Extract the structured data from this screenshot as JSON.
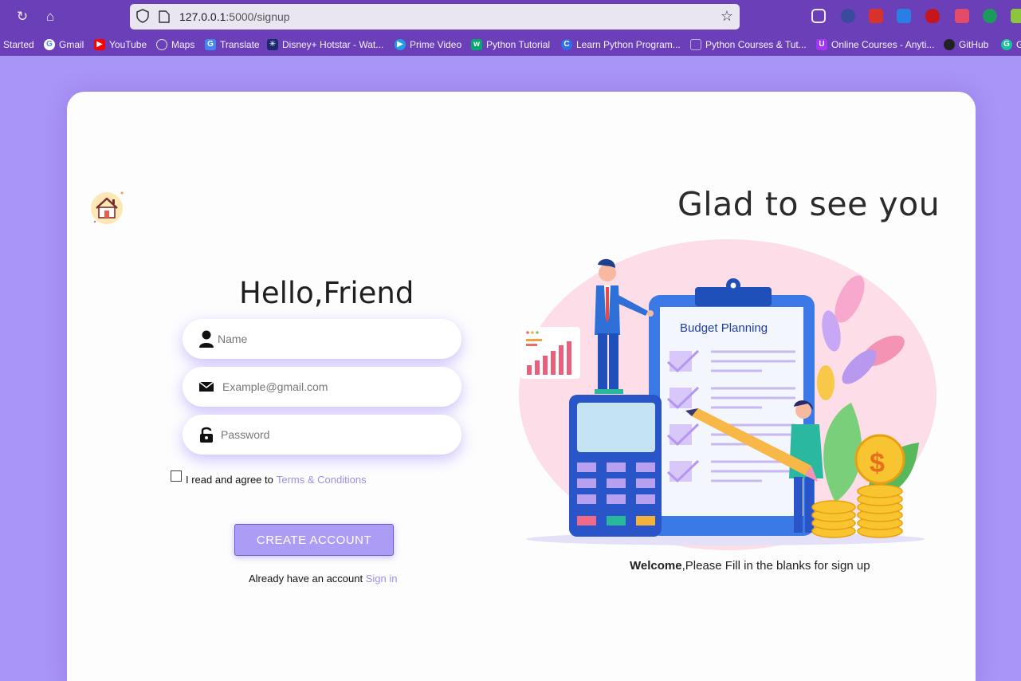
{
  "browser": {
    "url_host": "127.0.0.1",
    "url_path": ":5000/signup",
    "bookmarks": [
      {
        "label": "g Started",
        "icon": "firefox-icon",
        "color": "#ff8a00"
      },
      {
        "label": "Gmail",
        "icon": "google-icon",
        "color": "#ffffff"
      },
      {
        "label": "YouTube",
        "icon": "youtube-icon",
        "color": "#ff0000"
      },
      {
        "label": "Maps",
        "icon": "globe-icon",
        "color": "#d8d8d8"
      },
      {
        "label": "Translate",
        "icon": "translate-icon",
        "color": "#4285f4"
      },
      {
        "label": "Disney+ Hotstar - Wat...",
        "icon": "hotstar-icon",
        "color": "#1a2a6c"
      },
      {
        "label": "Prime Video",
        "icon": "prime-video-icon",
        "color": "#1f9ee8"
      },
      {
        "label": "Python Tutorial",
        "icon": "w3-icon",
        "color": "#04aa6d"
      },
      {
        "label": "Learn Python Program...",
        "icon": "c-icon",
        "color": "#2f6ee6"
      },
      {
        "label": "Python Courses & Tut...",
        "icon": "page-icon",
        "color": "#8b80c8"
      },
      {
        "label": "Online Courses - Anyti...",
        "icon": "udemy-icon",
        "color": "#a435f0"
      },
      {
        "label": "GitHub",
        "icon": "github-icon",
        "color": "#222222"
      },
      {
        "label": "G",
        "icon": "grammarly-icon",
        "color": "#15c39a"
      }
    ]
  },
  "page": {
    "heading": "Hello,Friend",
    "name_placeholder": "Name",
    "email_placeholder": "Example@gmail.com",
    "password_placeholder": "Password",
    "terms_text": "I read and agree to",
    "terms_link": "Terms & Conditions",
    "create_button": "CREATE ACCOUNT",
    "already_text": "Already have an account",
    "signin_link": "Sign in",
    "glad_heading": "Glad to see you",
    "illustration_title": "Budget  Planning",
    "welcome_bold": "Welcome",
    "welcome_rest": ",Please Fill in the blanks for sign up"
  },
  "colors": {
    "page_bg": "#a994f7",
    "accent": "#ad9cf6",
    "link": "#9a8ee8",
    "chrome": "#6b3fb8"
  }
}
